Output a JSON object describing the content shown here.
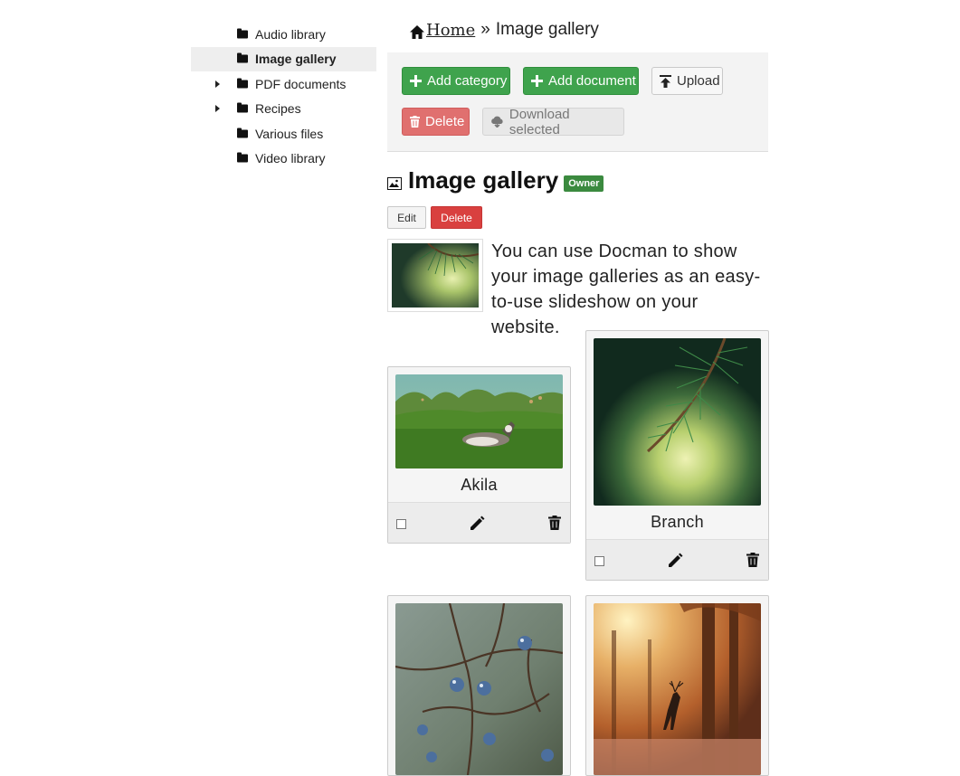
{
  "sidebar": {
    "items": [
      {
        "label": "Audio library",
        "expandable": false,
        "active": false
      },
      {
        "label": "Image gallery",
        "expandable": false,
        "active": true
      },
      {
        "label": "PDF documents",
        "expandable": true,
        "active": false
      },
      {
        "label": "Recipes",
        "expandable": true,
        "active": false
      },
      {
        "label": "Various files",
        "expandable": false,
        "active": false
      },
      {
        "label": "Video library",
        "expandable": false,
        "active": false
      }
    ]
  },
  "breadcrumb": {
    "home": "Home",
    "separator": "»",
    "current": "Image gallery"
  },
  "toolbar": {
    "add_category": "Add category",
    "add_document": "Add document",
    "upload": "Upload",
    "delete": "Delete",
    "download_selected": "Download selected"
  },
  "category": {
    "title": "Image gallery",
    "badge": "Owner",
    "edit_label": "Edit",
    "delete_label": "Delete",
    "description": "You can use Docman to show your image galleries as an easy-to-use slideshow on your website."
  },
  "documents": [
    {
      "name": "Akila",
      "image": "husky-on-grass"
    },
    {
      "name": "Branch",
      "image": "pine-branch"
    },
    {
      "name": "",
      "image": "blue-berries-branch"
    },
    {
      "name": "",
      "image": "deer-in-forest"
    }
  ],
  "colors": {
    "accent_green": "#3fa34d",
    "danger_red": "#d9403f",
    "owner_badge": "#3b8a3f"
  }
}
